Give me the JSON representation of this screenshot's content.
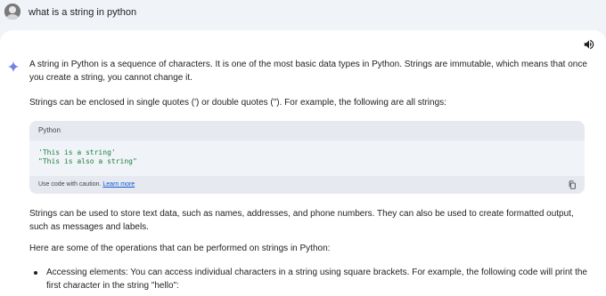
{
  "user": {
    "query": "what is a string in python"
  },
  "response": {
    "paragraphs": [
      "A string in Python is a sequence of characters. It is one of the most basic data types in Python. Strings are immutable, which means that once you create a string, you cannot change it.",
      "Strings can be enclosed in single quotes (') or double quotes (\"). For example, the following are all strings:",
      "Strings can be used to store text data, such as names, addresses, and phone numbers. They can also be used to create formatted output, such as messages and labels.",
      "Here are some of the operations that can be performed on strings in Python:"
    ],
    "code_block": {
      "language": "Python",
      "lines": [
        "'This is a string'",
        "\"This is also a string\""
      ],
      "footer_text": "Use code with caution.",
      "learn_more": "Learn more"
    },
    "bullets": [
      "Accessing elements: You can access individual characters in a string using square brackets. For example, the following code will print the first character in the string \"hello\":"
    ]
  },
  "colors": {
    "page_bg": "#f0f4f9",
    "card_bg": "#ffffff",
    "code_string": "#1e7d3a",
    "link": "#0b57d0"
  },
  "icons": {
    "avatar": "user-avatar",
    "speaker": "volume-icon",
    "sparkle": "gemini-sparkle-icon",
    "copy": "copy-icon"
  }
}
